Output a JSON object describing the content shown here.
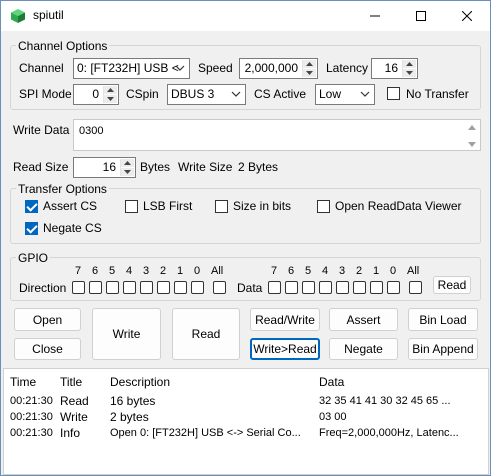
{
  "window": {
    "title": "spiutil"
  },
  "channel_options": {
    "label": "Channel Options",
    "channel_label": "Channel",
    "channel_value": "0: [FT232H] USB <",
    "speed_label": "Speed",
    "speed_value": "2,000,000",
    "latency_label": "Latency",
    "latency_value": "16",
    "spi_mode_label": "SPI Mode",
    "spi_mode_value": "0",
    "cspin_label": "CSpin",
    "cspin_value": "DBUS 3",
    "cs_active_label": "CS Active",
    "cs_active_value": "Low",
    "no_transfer_label": "No Transfer",
    "no_transfer_checked": false
  },
  "write_data": {
    "label": "Write Data",
    "value": "0300"
  },
  "read_size": {
    "label": "Read Size",
    "value": "16",
    "unit": "Bytes",
    "write_size_label": "Write Size",
    "write_size_value": "2 Bytes"
  },
  "transfer_options": {
    "label": "Transfer Options",
    "assert_cs": {
      "label": "Assert CS",
      "checked": true
    },
    "lsb_first": {
      "label": "LSB First",
      "checked": false
    },
    "size_in_bits": {
      "label": "Size in bits",
      "checked": false
    },
    "open_readdata_viewer": {
      "label": "Open ReadData Viewer",
      "checked": false
    },
    "negate_cs": {
      "label": "Negate CS",
      "checked": true
    }
  },
  "gpio": {
    "label": "GPIO",
    "direction_label": "Direction",
    "data_label": "Data",
    "bits": [
      "7",
      "6",
      "5",
      "4",
      "3",
      "2",
      "1",
      "0"
    ],
    "all_label": "All",
    "read_button": "Read"
  },
  "buttons": {
    "open": "Open",
    "close": "Close",
    "write": "Write",
    "read": "Read",
    "read_write": "Read/Write",
    "write_read": "Write>Read",
    "assert": "Assert",
    "negate": "Negate",
    "bin_load": "Bin Load",
    "bin_append": "Bin Append"
  },
  "log": {
    "columns": [
      "Time",
      "Title",
      "Description",
      "Data"
    ],
    "rows": [
      [
        "00:21:30",
        "Read",
        "16 bytes",
        "32 35 41 41 30 32 45 65 ..."
      ],
      [
        "00:21:30",
        "Write",
        "2 bytes",
        "03 00"
      ],
      [
        "00:21:30",
        "Info",
        "Open 0: [FT232H] USB <-> Serial Co...",
        "Freq=2,000,000Hz, Latenc..."
      ]
    ]
  },
  "colors": {
    "accent": "#0067c0",
    "background": "#f0f0f0",
    "icon_green": "#2fa84f"
  }
}
